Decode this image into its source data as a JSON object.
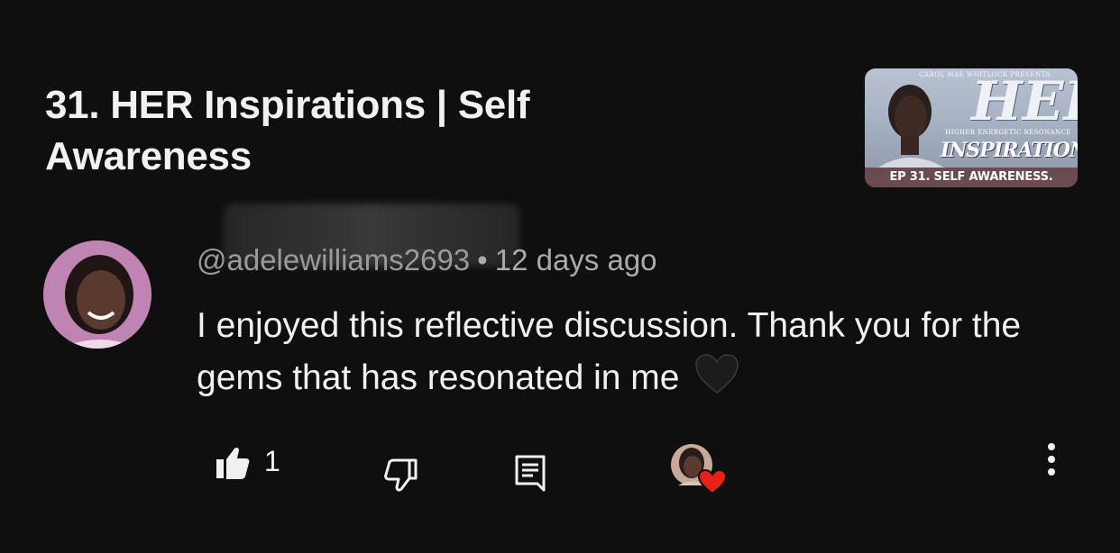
{
  "video": {
    "title": "31. HER Inspirations | Self Awareness",
    "thumbnail": {
      "presents": "Carol Mae Whitlock presents",
      "brand": "HER",
      "subtitle": "Higher Energetic Resonance",
      "series": "Inspirations",
      "episode": "EP 31. Self Awareness."
    }
  },
  "comment": {
    "author_handle": "@adelewilliams2693",
    "separator": "•",
    "timestamp": "12 days ago",
    "text": "I enjoyed this reflective discussion. Thank you for the gems that has resonated in me",
    "emoji": "black-heart",
    "like_count": "1",
    "creator_hearted": true
  },
  "icons": {
    "like": "thumbs-up-icon",
    "dislike": "thumbs-down-icon",
    "reply": "reply-icon",
    "creator_heart": "creator-heart-icon",
    "more": "more-vertical-icon"
  },
  "colors": {
    "background": "#0f0f0f",
    "text_primary": "#f1f1f1",
    "text_secondary": "#aaaaaa",
    "heart_red": "#e62117"
  }
}
